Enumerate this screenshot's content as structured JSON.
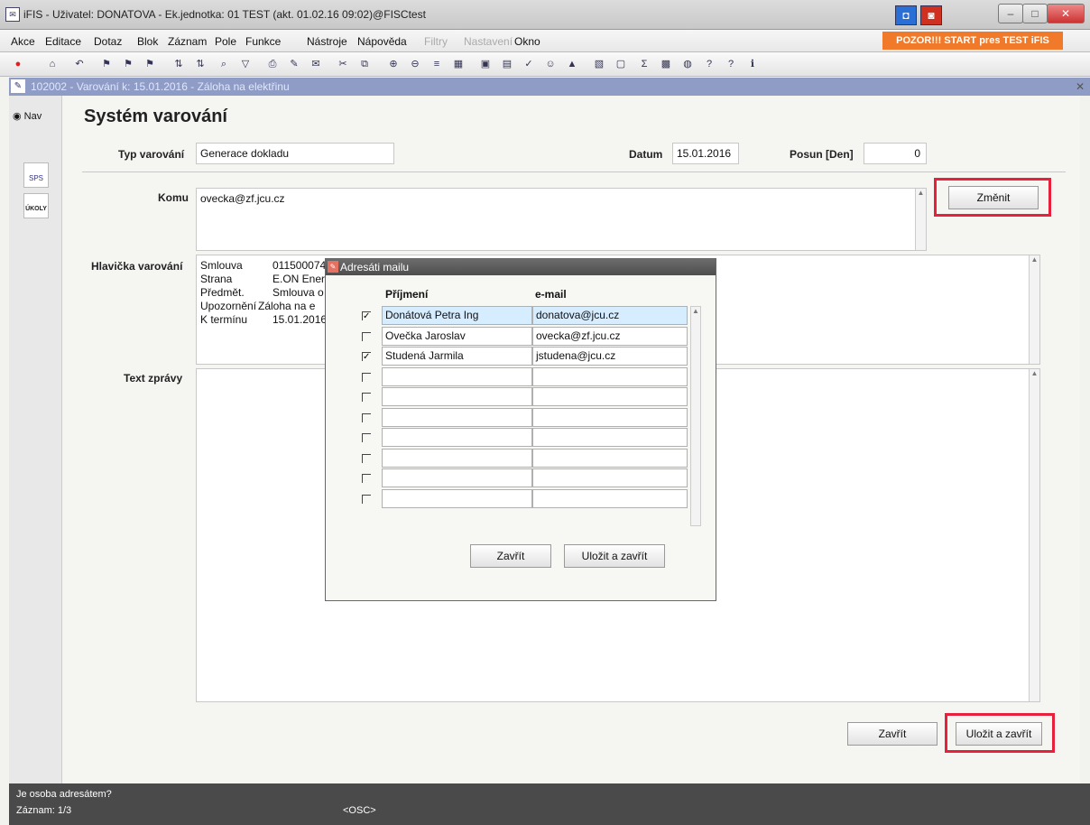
{
  "window": {
    "title": "iFIS - Uživatel: DONATOVA - Ek.jednotka: 01 TEST (akt. 01.02.16 09:02)@FISCtest"
  },
  "menu": {
    "items": [
      "Akce",
      "Editace",
      "Dotaz",
      "Blok",
      "Záznam",
      "Pole",
      "Funkce",
      "Nástroje",
      "Nápověda",
      "Filtry",
      "Nastavení",
      "Okno"
    ],
    "warning": "POZOR!!! START pres TEST iFIS"
  },
  "form_header": {
    "title": "102002 - Varování k: 15.01.2016 - Záloha na elektřinu"
  },
  "nav": {
    "label": "Nav",
    "icon1_label": "SPS",
    "icon2_label": "ÚKOLY"
  },
  "main": {
    "title": "Systém varování",
    "typ_label": "Typ varování",
    "typ_value": "Generace dokladu",
    "datum_label": "Datum",
    "datum_value": "15.01.2016",
    "posun_label": "Posun [Den]",
    "posun_value": "0",
    "komu_label": "Komu",
    "komu_value": "ovecka@zf.jcu.cz",
    "zmenit_label": "Změnit",
    "hlavicka_label": "Hlavička varování",
    "hlavicka_rows": [
      {
        "key": "Smlouva",
        "value": "0115000740"
      },
      {
        "key": "Strana",
        "value": "E.ON Energie"
      },
      {
        "key": "Předmět.",
        "value": "Smlouva o"
      },
      {
        "key": "Upozornění",
        "value": "Záloha na e"
      },
      {
        "key": "K termínu",
        "value": "15.01.2016"
      }
    ],
    "text_label": "Text zprávy",
    "zavrit_label": "Zavřít",
    "ulozit_label": "Uložit a zavřít"
  },
  "dialog": {
    "title": "Adresáti mailu",
    "col_name": "Příjmení",
    "col_email": "e-mail",
    "rows": [
      {
        "checked": "✓",
        "name": "Donátová Petra Ing",
        "email": "donatova@jcu.cz"
      },
      {
        "checked": "",
        "name": "Ovečka Jaroslav",
        "email": "ovecka@zf.jcu.cz"
      },
      {
        "checked": "✓",
        "name": "Studená Jarmila",
        "email": "jstudena@jcu.cz"
      },
      {
        "checked": "",
        "name": "",
        "email": ""
      },
      {
        "checked": "",
        "name": "",
        "email": ""
      },
      {
        "checked": "",
        "name": "",
        "email": ""
      },
      {
        "checked": "",
        "name": "",
        "email": ""
      },
      {
        "checked": "",
        "name": "",
        "email": ""
      },
      {
        "checked": "",
        "name": "",
        "email": ""
      },
      {
        "checked": "",
        "name": "",
        "email": ""
      }
    ],
    "zavrit_label": "Zavřít",
    "ulozit_label": "Uložit a zavřít"
  },
  "status": {
    "line1": "Je osoba adresátem?",
    "record": "Záznam: 1/3",
    "osc": "<OSC>"
  }
}
